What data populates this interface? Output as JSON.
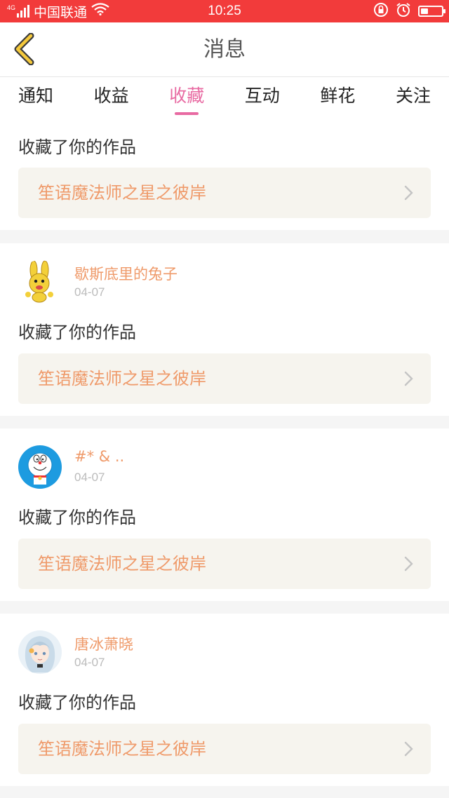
{
  "status_bar": {
    "network": "4G",
    "carrier": "中国联通",
    "time": "10:25",
    "battery_level": 0.35
  },
  "header": {
    "title": "消息",
    "back_icon": "chevron-left-icon"
  },
  "tabs": [
    {
      "label": "通知",
      "active": false
    },
    {
      "label": "收益",
      "active": false
    },
    {
      "label": "收藏",
      "active": true
    },
    {
      "label": "互动",
      "active": false
    },
    {
      "label": "鲜花",
      "active": false
    },
    {
      "label": "关注",
      "active": false
    }
  ],
  "messages": [
    {
      "action": "收藏了你的作品",
      "work_title": "笙语魔法师之星之彼岸"
    },
    {
      "username": "歇斯底里的兔子",
      "date": "04-07",
      "avatar": "rabbit-avatar",
      "action": "收藏了你的作品",
      "work_title": "笙语魔法师之星之彼岸"
    },
    {
      "username": "#* & ..",
      "date": "04-07",
      "avatar": "doraemon-avatar",
      "action": "收藏了你的作品",
      "work_title": "笙语魔法师之星之彼岸"
    },
    {
      "username": "唐冰萧晓",
      "date": "04-07",
      "avatar": "anime-girl-avatar",
      "action": "收藏了你的作品",
      "work_title": "笙语魔法师之星之彼岸"
    }
  ],
  "colors": {
    "status_bar": "#f23b3b",
    "accent": "#e86aa2",
    "name_orange": "#ef9a6a",
    "work_bg": "#f6f4ee"
  }
}
